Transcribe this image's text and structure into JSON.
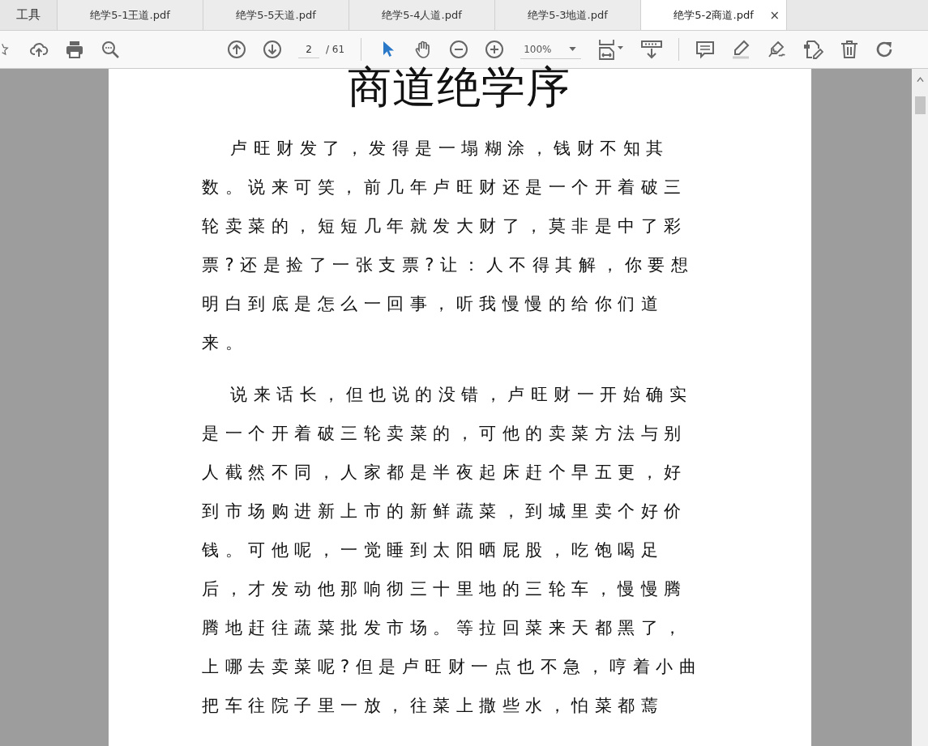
{
  "tabs": [
    {
      "label": "工具",
      "kind": "home",
      "selected": false
    },
    {
      "label": "绝学5-1王道.pdf",
      "kind": "doc",
      "selected": false
    },
    {
      "label": "绝学5-5天道.pdf",
      "kind": "doc",
      "selected": false
    },
    {
      "label": "绝学5-4人道.pdf",
      "kind": "doc",
      "selected": false
    },
    {
      "label": "绝学5-3地道.pdf",
      "kind": "doc",
      "selected": false
    },
    {
      "label": "绝学5-2商道.pdf",
      "kind": "doc",
      "selected": true,
      "close": "×"
    }
  ],
  "toolbar": {
    "page_value": "2",
    "page_total": "/ 61",
    "zoom": "100%",
    "pointer_tools": [
      {
        "selected": true
      },
      {
        "selected": false
      }
    ]
  },
  "document": {
    "title": "商道绝学序",
    "paragraphs": [
      [
        "卢旺财发了，发得是一塌糊涂，钱财不知其",
        "数。说来可笑，前几年卢旺财还是一个开着破三",
        "轮卖菜的，短短几年就发大财了，莫非是中了彩",
        "票?还是捡了一张支票?让：人不得其解，你要想",
        "明白到底是怎么一回事，听我慢慢的给你们道",
        "来。"
      ],
      [
        "说来话长，但也说的没错，卢旺财一开始确实",
        "是一个开着破三轮卖菜的，可他的卖菜方法与别",
        "人截然不同，人家都是半夜起床赶个早五更，好",
        "到市场购进新上市的新鲜蔬菜，到城里卖个好价",
        "钱。可他呢，一觉睡到太阳晒屁股，吃饱喝足",
        "后，才发动他那响彻三十里地的三轮车，慢慢腾",
        "腾地赶往蔬菜批发市场。等拉回菜来天都黑了，",
        "上哪去卖菜呢?但是卢旺财一点也不急，哼着小曲",
        "把车往院子里一放，往菜上撒些水，怕菜都蔫"
      ]
    ]
  }
}
